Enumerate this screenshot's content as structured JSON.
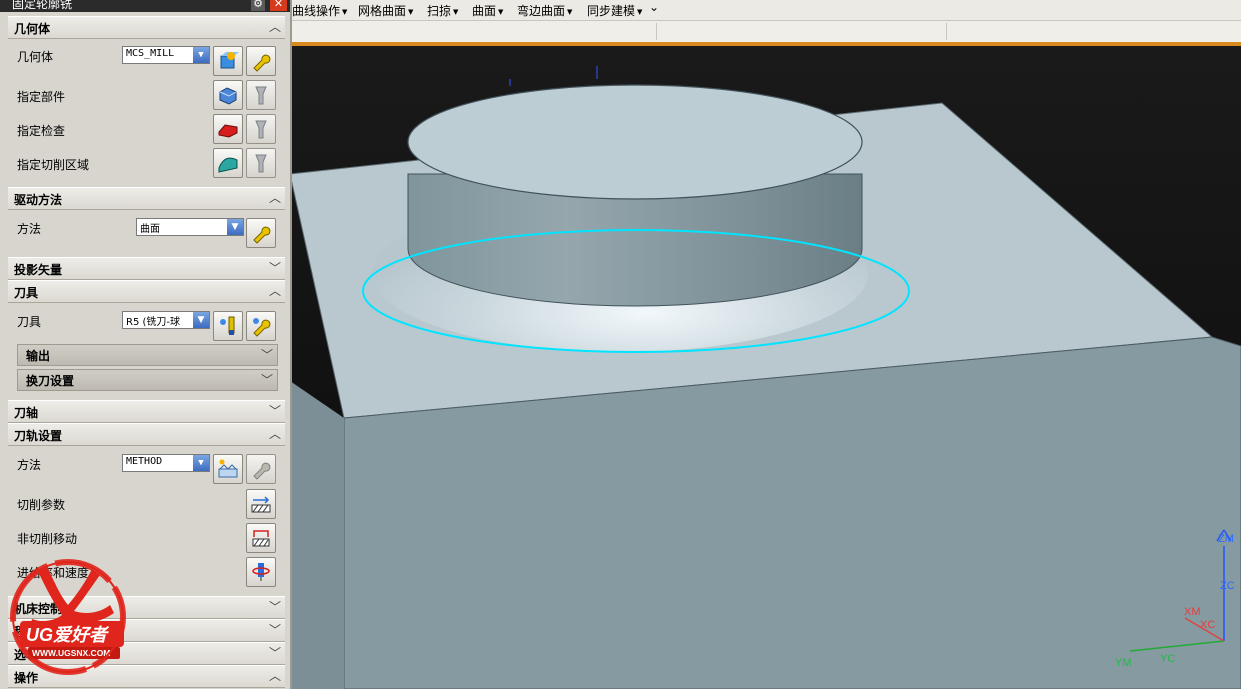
{
  "menubar": {
    "items": [
      {
        "label": "曲线操作"
      },
      {
        "label": "网格曲面"
      },
      {
        "label": "扫掠"
      },
      {
        "label": "曲面"
      },
      {
        "label": "弯边曲面"
      },
      {
        "label": "同步建模"
      }
    ],
    "overflow": "⌄"
  },
  "dialog": {
    "title": "固定轮廓铣",
    "sections": {
      "geometry": {
        "title": "几何体",
        "geometry_label": "几何体",
        "geometry_value": "MCS_MILL",
        "part_label": "指定部件",
        "check_label": "指定检查",
        "cut_area_label": "指定切削区域"
      },
      "drive": {
        "title": "驱动方法",
        "method_label": "方法",
        "method_value": "曲面"
      },
      "projection": {
        "title": "投影矢量"
      },
      "tool": {
        "title": "刀具",
        "tool_label": "刀具",
        "tool_value": "R5 (铣刀-球",
        "output_label": "输出",
        "tool_change_label": "换刀设置"
      },
      "axis": {
        "title": "刀轴"
      },
      "path_settings": {
        "title": "刀轨设置",
        "method_label": "方法",
        "method_value": "METHOD",
        "cut_params_label": "切削参数",
        "non_cut_label": "非切削移动",
        "feeds_label": "进给率和速度"
      },
      "machine": {
        "title": "机床控制"
      },
      "program": {
        "title": "程序"
      },
      "options": {
        "title": "选项"
      },
      "actions": {
        "title": "操作"
      }
    }
  },
  "watermark": {
    "brand": "UG爱好者",
    "url": "WWW.UGSNX.COM"
  },
  "axes": {
    "zm": "ZM",
    "zc": "ZC",
    "xm": "XM",
    "xc": "XC",
    "ym": "YM",
    "yc": "YC"
  },
  "colors": {
    "accent": "#d98a1e",
    "highlight": "#00e5ff",
    "part": "#b9c8cf"
  }
}
